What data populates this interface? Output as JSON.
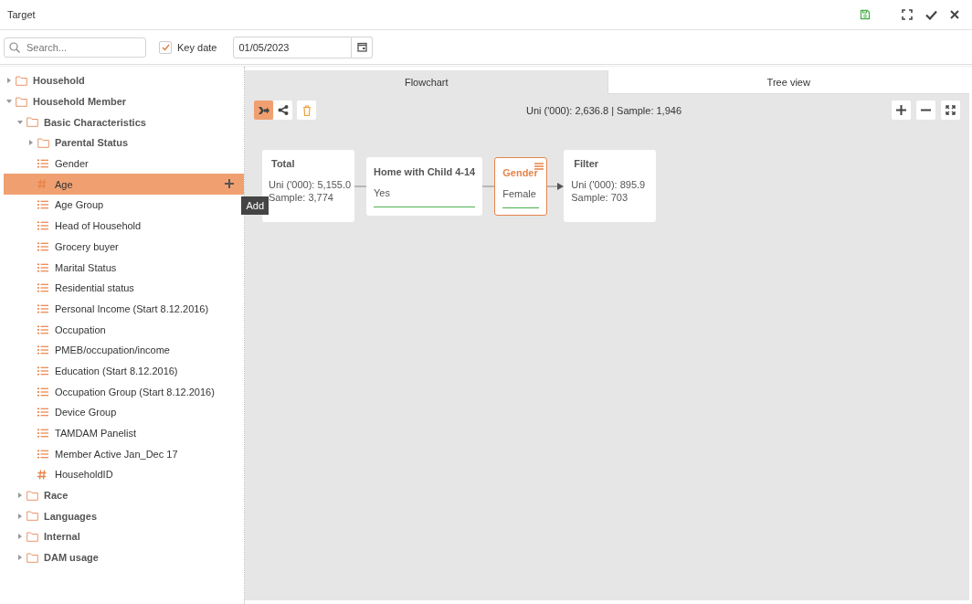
{
  "window": {
    "title": "Target"
  },
  "search": {
    "placeholder": "Search..."
  },
  "key_date": {
    "label": "Key date",
    "checked": true,
    "value": "01/05/2023"
  },
  "tree": [
    {
      "label": "Household",
      "kind": "folder",
      "expanded": false,
      "selected": false
    },
    {
      "label": "Household Member",
      "kind": "folder",
      "expanded": true,
      "selected": false,
      "children": [
        {
          "label": "Basic Characteristics",
          "kind": "folder",
          "expanded": true,
          "selected": false,
          "children": [
            {
              "label": "Parental Status",
              "kind": "folder",
              "expanded": false,
              "selected": false
            },
            {
              "label": "Gender",
              "kind": "list",
              "selected": false
            },
            {
              "label": "Age",
              "kind": "number",
              "selected": true
            },
            {
              "label": "Age Group",
              "kind": "list",
              "selected": false
            },
            {
              "label": "Head of Household",
              "kind": "list",
              "selected": false
            },
            {
              "label": "Grocery buyer",
              "kind": "list",
              "selected": false
            },
            {
              "label": "Marital Status",
              "kind": "list",
              "selected": false
            },
            {
              "label": "Residential status",
              "kind": "list",
              "selected": false
            },
            {
              "label": "Personal Income (Start 8.12.2016)",
              "kind": "list",
              "selected": false
            },
            {
              "label": "Occupation",
              "kind": "list",
              "selected": false
            },
            {
              "label": "PMEB/occupation/income",
              "kind": "list",
              "selected": false
            },
            {
              "label": "Education (Start 8.12.2016)",
              "kind": "list",
              "selected": false
            },
            {
              "label": "Occupation Group (Start 8.12.2016)",
              "kind": "list",
              "selected": false
            },
            {
              "label": "Device Group",
              "kind": "list",
              "selected": false
            },
            {
              "label": "TAMDAM Panelist",
              "kind": "list",
              "selected": false
            },
            {
              "label": "Member Active Jan_Dec 17",
              "kind": "list",
              "selected": false
            },
            {
              "label": "HouseholdID",
              "kind": "number",
              "selected": false
            }
          ]
        },
        {
          "label": "Race",
          "kind": "folder",
          "expanded": false,
          "selected": false
        },
        {
          "label": "Languages",
          "kind": "folder",
          "expanded": false,
          "selected": false
        },
        {
          "label": "Internal",
          "kind": "folder",
          "expanded": false,
          "selected": false
        },
        {
          "label": "DAM usage",
          "kind": "folder",
          "expanded": false,
          "selected": false
        }
      ]
    }
  ],
  "tooltip": "Add",
  "tabs": [
    {
      "label": "Flowchart",
      "selected": true
    },
    {
      "label": "Tree view",
      "selected": false
    }
  ],
  "view_modes": [
    {
      "kind": "flow",
      "selected": true
    },
    {
      "kind": "branch",
      "selected": false
    }
  ],
  "summary": "Uni ('000): 2,636.8 | Sample: 1,946",
  "nodes": [
    {
      "kind": "total",
      "title": "Total",
      "lines": [
        "Uni ('000): 5,155.0",
        "Sample: 3,774"
      ]
    },
    {
      "kind": "condition",
      "title": "Home with Child 4-14",
      "value": "Yes",
      "selected": false
    },
    {
      "kind": "condition",
      "title": "Gender",
      "value": "Female",
      "selected": true
    },
    {
      "kind": "result",
      "title": "Filter",
      "lines": [
        "Uni ('000): 895.9",
        "Sample: 703"
      ]
    }
  ]
}
